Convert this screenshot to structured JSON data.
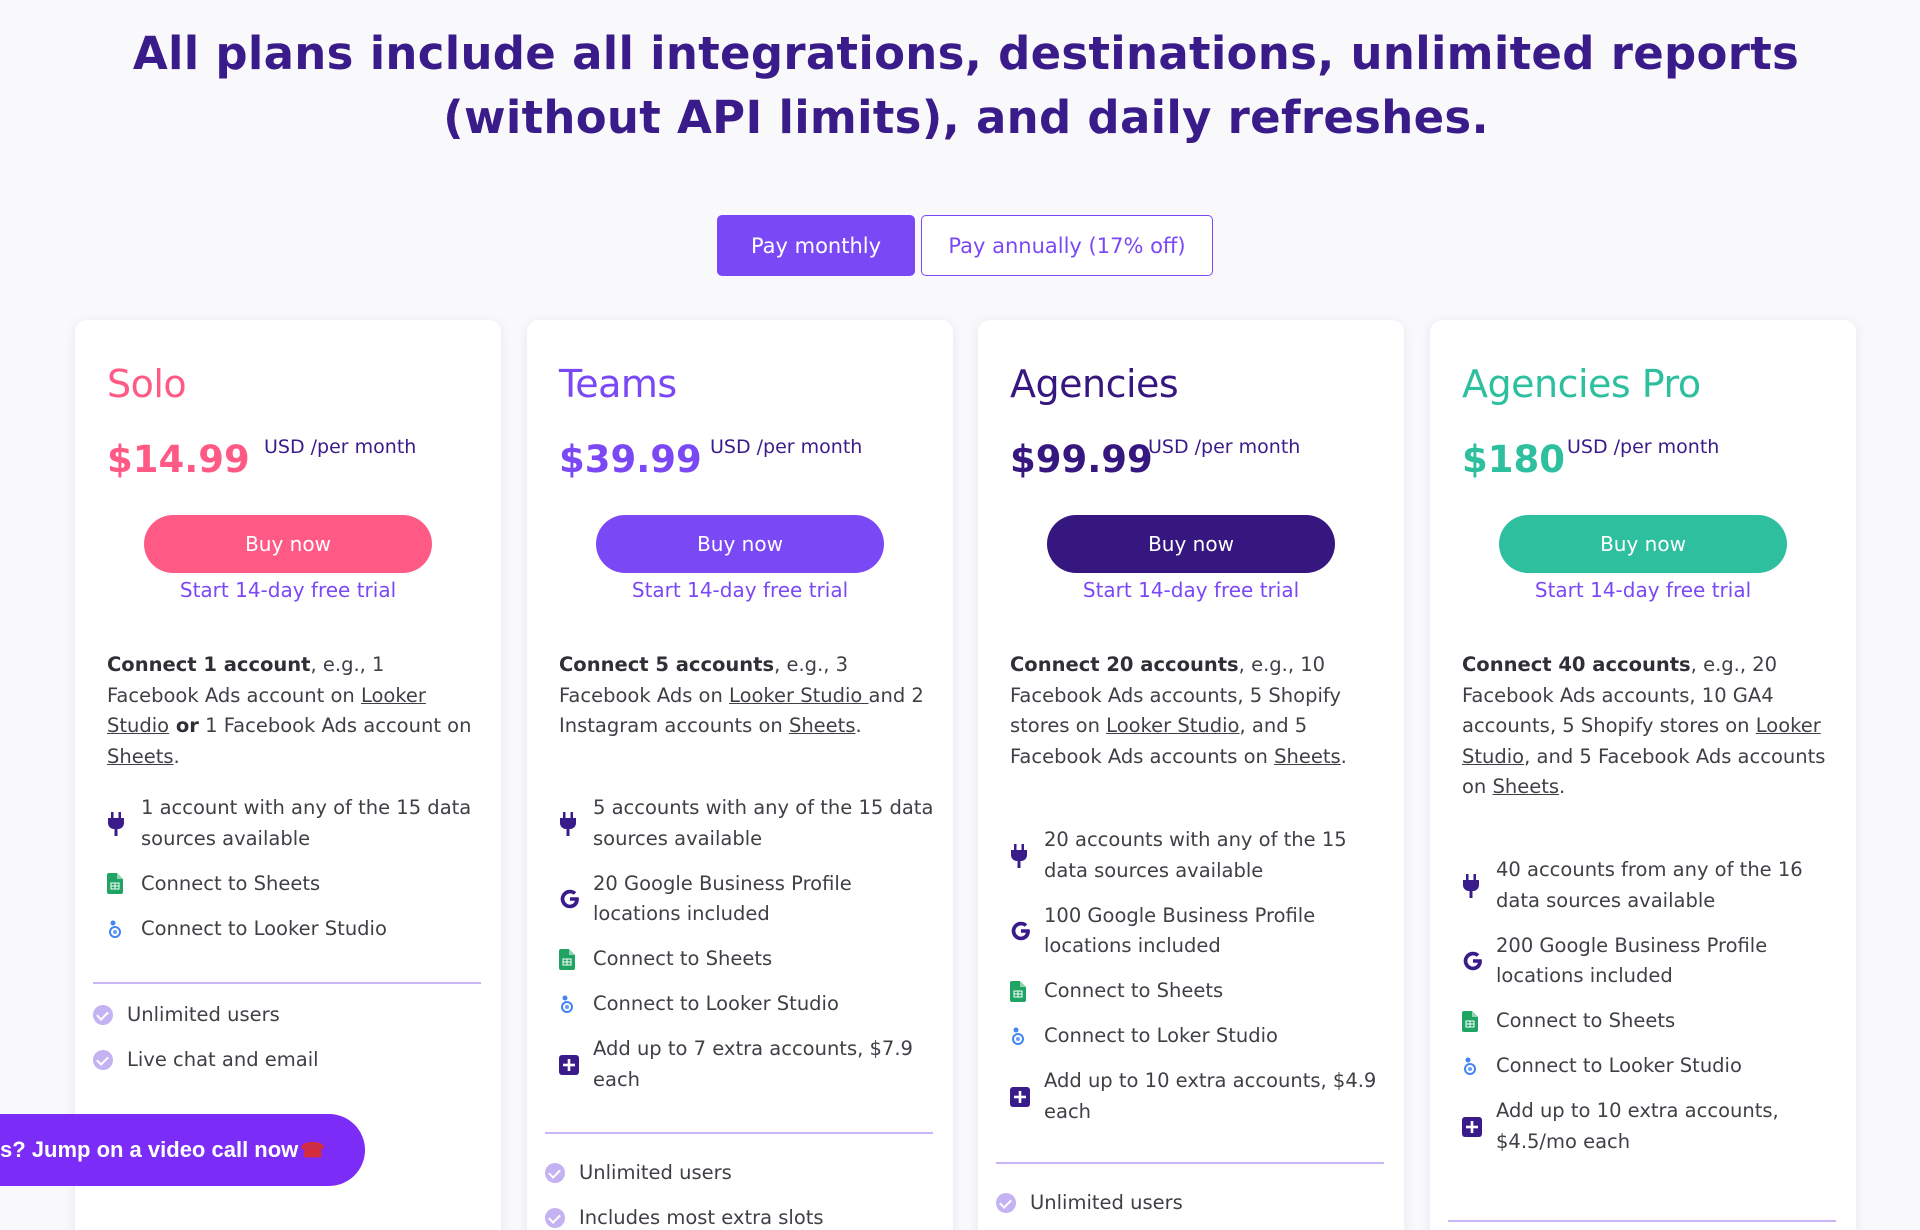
{
  "headline": {
    "line1": "All plans include all integrations, destinations, unlimited reports",
    "line2": "(without API limits), and daily refreshes."
  },
  "billing_toggle": {
    "monthly_label": "Pay monthly",
    "annual_label": "Pay annually (17% off)",
    "selected": "monthly"
  },
  "colors": {
    "solo": "#ff5a86",
    "teams": "#7b48f6",
    "agencies": "#36167f",
    "agencies_pro": "#2dbf9e",
    "purple_link": "#7b48f6",
    "headline": "#3a1b8a"
  },
  "plans": [
    {
      "name": "Solo",
      "price": "$14.99",
      "price_unit": "USD /per month",
      "buy_label": "Buy now",
      "trial_label": "Start 14-day free trial",
      "connect": {
        "bold": "Connect 1 account",
        "t1": ", e.g., 1 Facebook Ads account on ",
        "link1": "Looker Studio",
        "or": " or",
        "t2": " 1 Facebook Ads account on ",
        "link2": "Sheets",
        "end": "."
      },
      "features": [
        {
          "icon": "plug-icon",
          "text": "1 account with any of the 15 data sources available"
        },
        {
          "icon": "sheets-icon",
          "text": "Connect to Sheets"
        },
        {
          "icon": "looker-studio-icon",
          "text": "Connect to Looker Studio"
        }
      ],
      "extras": [
        "Unlimited users",
        "Live chat and email"
      ]
    },
    {
      "name": "Teams",
      "price": "$39.99",
      "price_unit": "USD /per month",
      "buy_label": "Buy now",
      "trial_label": "Start 14-day free trial",
      "connect": {
        "bold": "Connect 5 accounts",
        "t1": ", e.g., 3 Facebook Ads on ",
        "link1": "Looker Studio ",
        "t2": "and 2 Instagram accounts on ",
        "link2": "Sheets",
        "end": "."
      },
      "features": [
        {
          "icon": "plug-icon",
          "text": "5 accounts with any of the 15 data sources available"
        },
        {
          "icon": "google-icon",
          "text": "20 Google Business Profile locations included"
        },
        {
          "icon": "sheets-icon",
          "text": "Connect to Sheets"
        },
        {
          "icon": "looker-studio-icon",
          "text": "Connect to Looker Studio"
        },
        {
          "icon": "plus-square-icon",
          "text": "Add up to 7 extra accounts, $7.9 each"
        }
      ],
      "extras": [
        "Unlimited users",
        "Includes most extra slots"
      ]
    },
    {
      "name": "Agencies",
      "price": "$99.99",
      "price_unit": "USD /per month",
      "buy_label": "Buy now",
      "trial_label": "Start 14-day free trial",
      "connect": {
        "bold": "Connect 20 accounts",
        "t1": ", e.g., 10 Facebook Ads accounts, 5 Shopify stores on ",
        "link1": "Looker Studio",
        "t2": ", and 5 Facebook Ads accounts on ",
        "link2": "Sheets",
        "end": "."
      },
      "features": [
        {
          "icon": "plug-icon",
          "text": "20 accounts with any of the 15 data sources available"
        },
        {
          "icon": "google-icon",
          "text": "100 Google Business Profile locations included"
        },
        {
          "icon": "sheets-icon",
          "text": "Connect to Sheets"
        },
        {
          "icon": "looker-studio-icon",
          "text": "Connect to Loker Studio"
        },
        {
          "icon": "plus-square-icon",
          "text": "Add up to 10 extra accounts, $4.9 each"
        }
      ],
      "extras": [
        "Unlimited users"
      ]
    },
    {
      "name": "Agencies Pro",
      "price": "$180",
      "price_unit": "USD /per month",
      "buy_label": "Buy now",
      "trial_label": "Start 14-day free trial",
      "connect": {
        "bold": "Connect 40 accounts",
        "t1": ", e.g., 20 Facebook Ads accounts, 10 GA4 accounts,  5 Shopify stores on ",
        "link1": "Looker Studio",
        "t2": ", and 5 Facebook Ads accounts on ",
        "link2": "Sheets",
        "end": "."
      },
      "features": [
        {
          "icon": "plug-icon",
          "text": "40 accounts from any of the 16 data sources available"
        },
        {
          "icon": "google-icon",
          "text": "200 Google Business Profile locations included"
        },
        {
          "icon": "sheets-icon",
          "text": "Connect to Sheets"
        },
        {
          "icon": "looker-studio-icon",
          "text": "Connect to Looker Studio"
        },
        {
          "icon": "plus-square-icon",
          "text": "Add up to 10 extra accounts, $4.5/mo each"
        }
      ],
      "extras": []
    }
  ],
  "chat_widget": {
    "label": "s? Jump on a video call now",
    "icon": "telephone-icon"
  }
}
